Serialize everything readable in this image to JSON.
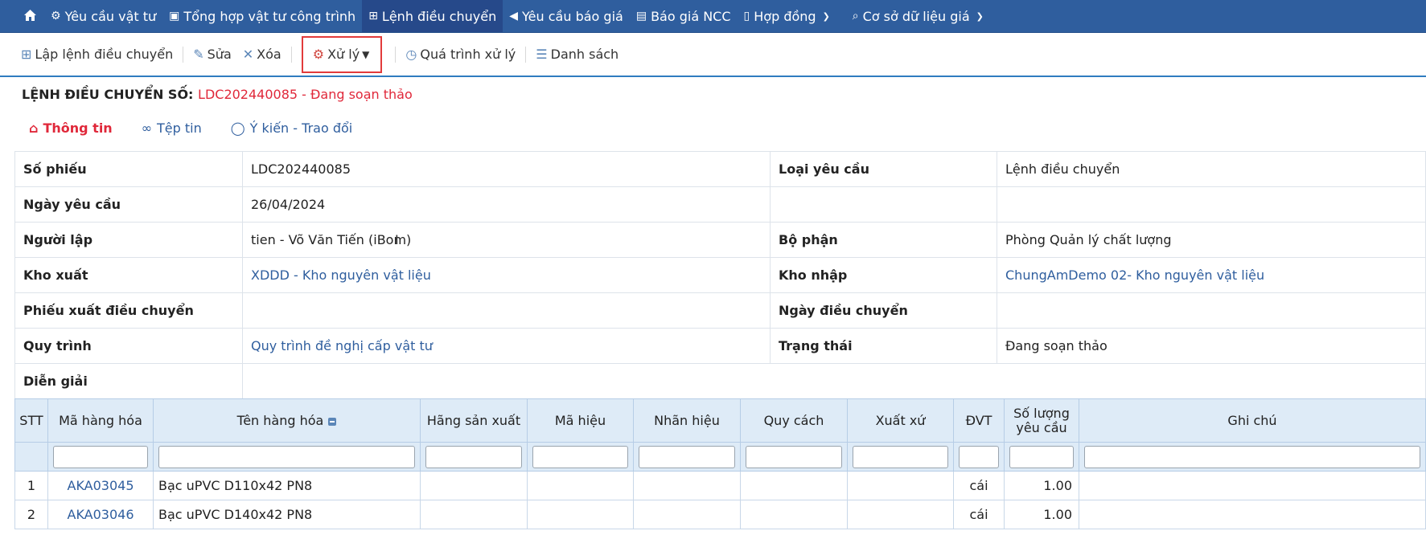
{
  "nav": {
    "home_icon": "home-icon",
    "items": [
      {
        "label": "Yêu cầu vật tư",
        "icon": "gear-user-icon"
      },
      {
        "label": "Tổng hợp vật tư công trình",
        "icon": "picture-icon"
      },
      {
        "label": "Lệnh điều chuyển",
        "icon": "sitemap-icon"
      },
      {
        "label": "Yêu cầu báo giá",
        "icon": "megaphone-icon"
      },
      {
        "label": "Báo giá NCC",
        "icon": "building-icon"
      },
      {
        "label": "Hợp đồng",
        "icon": "document-icon"
      },
      {
        "label": "Cơ sở dữ liệu giá",
        "icon": "search-doc-icon"
      }
    ]
  },
  "toolbar": {
    "create": "Lập lệnh điều chuyển",
    "edit": "Sửa",
    "delete": "Xóa",
    "process": "Xử lý",
    "history": "Quá trình xử lý",
    "list": "Danh sách"
  },
  "header": {
    "title_prefix": "LỆNH ĐIỀU CHUYỂN SỐ:",
    "title_code": "LDC202440085 - Đang soạn thảo"
  },
  "tabs": {
    "info": "Thông tin",
    "files": "Tệp tin",
    "comments": "Ý kiến - Trao đổi"
  },
  "info": {
    "so_phieu_label": "Số phiếu",
    "so_phieu": "LDC202440085",
    "loai_yeu_cau_label": "Loại yêu cầu",
    "loai_yeu_cau": "Lệnh điều chuyển",
    "ngay_yeu_cau_label": "Ngày yêu cầu",
    "ngay_yeu_cau": "26/04/2024",
    "nguoi_lap_label": "Người lập",
    "nguoi_lap": "tien - Võ Văn Tiến (iBom)",
    "bo_phan_label": "Bộ phận",
    "bo_phan": "Phòng Quản lý chất lượng",
    "kho_xuat_label": "Kho xuất",
    "kho_xuat": "XDDD - Kho nguyên vật liệu",
    "kho_nhap_label": "Kho nhập",
    "kho_nhap": "ChungAmDemo 02- Kho nguyên vật liệu",
    "phieu_xuat_label": "Phiếu xuất điều chuyển",
    "phieu_xuat": "",
    "ngay_dieu_chuyen_label": "Ngày điều chuyển",
    "ngay_dieu_chuyen": "",
    "quy_trinh_label": "Quy trình",
    "quy_trinh": "Quy trình đề nghị cấp vật tư",
    "trang_thai_label": "Trạng thái",
    "trang_thai": "Đang soạn thảo",
    "dien_giai_label": "Diễn giải",
    "dien_giai": ""
  },
  "table": {
    "headers": {
      "stt": "STT",
      "ma_hang": "Mã hàng hóa",
      "ten_hang": "Tên hàng hóa",
      "hang_sx": "Hãng sản xuất",
      "ma_hieu": "Mã hiệu",
      "nhan_hieu": "Nhãn hiệu",
      "quy_cach": "Quy cách",
      "xuat_xu": "Xuất xứ",
      "dvt": "ĐVT",
      "so_luong": "Số lượng yêu cầu",
      "ghi_chu": "Ghi chú"
    },
    "rows": [
      {
        "stt": "1",
        "ma_hang": "AKA03045",
        "ten_hang": "Bạc uPVC D110x42 PN8",
        "hang_sx": "",
        "ma_hieu": "",
        "nhan_hieu": "",
        "quy_cach": "",
        "xuat_xu": "",
        "dvt": "cái",
        "so_luong": "1.00",
        "ghi_chu": ""
      },
      {
        "stt": "2",
        "ma_hang": "AKA03046",
        "ten_hang": "Bạc uPVC D140x42 PN8",
        "hang_sx": "",
        "ma_hieu": "",
        "nhan_hieu": "",
        "quy_cach": "",
        "xuat_xu": "",
        "dvt": "cái",
        "so_luong": "1.00",
        "ghi_chu": ""
      }
    ]
  },
  "colors": {
    "nav_bg": "#2f5e9e",
    "accent_red": "#e0283a",
    "link": "#2f5e9e",
    "grid_header": "#deebf7"
  }
}
